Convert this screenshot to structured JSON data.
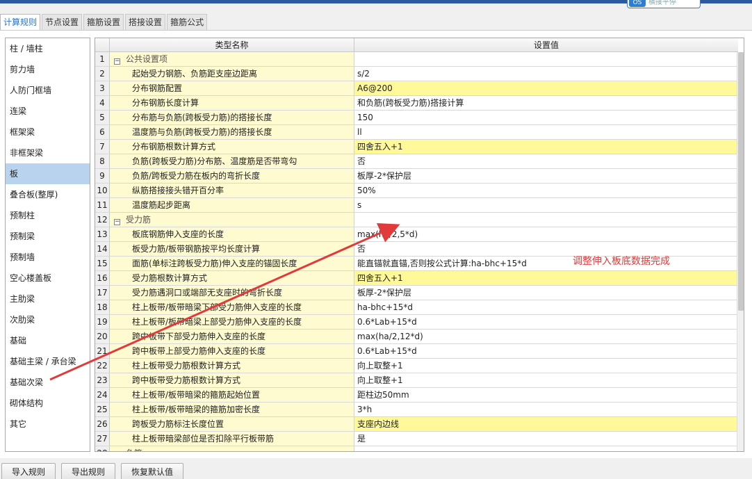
{
  "top_badge": "横接平停",
  "tabs": [
    {
      "label": "计算规则",
      "active": true
    },
    {
      "label": "节点设置"
    },
    {
      "label": "箍筋设置"
    },
    {
      "label": "搭接设置"
    },
    {
      "label": "箍筋公式"
    }
  ],
  "sidebar": {
    "items": [
      {
        "label": "柱 / 墙柱"
      },
      {
        "label": "剪力墙"
      },
      {
        "label": "人防门框墙"
      },
      {
        "label": "连梁"
      },
      {
        "label": "框架梁"
      },
      {
        "label": "非框架梁"
      },
      {
        "label": "板",
        "active": true
      },
      {
        "label": "叠合板(整厚)"
      },
      {
        "label": "预制柱"
      },
      {
        "label": "预制梁"
      },
      {
        "label": "预制墙"
      },
      {
        "label": "空心楼盖板"
      },
      {
        "label": "主肋梁"
      },
      {
        "label": "次肋梁"
      },
      {
        "label": "基础"
      },
      {
        "label": "基础主梁 / 承台梁"
      },
      {
        "label": "基础次梁"
      },
      {
        "label": "砌体结构"
      },
      {
        "label": "其它"
      }
    ]
  },
  "grid": {
    "header": {
      "num": "",
      "name": "类型名称",
      "value": "设置值"
    },
    "rows": [
      {
        "n": "1",
        "name": "公共设置项",
        "value": "",
        "group": true,
        "toggle": "−"
      },
      {
        "n": "2",
        "name": "起始受力钢筋、负筋距支座边距离",
        "value": "s/2"
      },
      {
        "n": "3",
        "name": "分布钢筋配置",
        "value": "A6@200",
        "hl": true
      },
      {
        "n": "4",
        "name": "分布钢筋长度计算",
        "value": "和负筋(跨板受力筋)搭接计算"
      },
      {
        "n": "5",
        "name": "分布筋与负筋(跨板受力筋)的搭接长度",
        "value": "150"
      },
      {
        "n": "6",
        "name": "温度筋与负筋(跨板受力筋)的搭接长度",
        "value": "ll"
      },
      {
        "n": "7",
        "name": "分布钢筋根数计算方式",
        "value": "四舍五入+1",
        "hl": true
      },
      {
        "n": "8",
        "name": "负筋(跨板受力筋)分布筋、温度筋是否带弯勾",
        "value": "否"
      },
      {
        "n": "9",
        "name": "负筋/跨板受力筋在板内的弯折长度",
        "value": "板厚-2*保护层"
      },
      {
        "n": "10",
        "name": "纵筋搭接接头错开百分率",
        "value": "50%"
      },
      {
        "n": "11",
        "name": "温度筋起步距离",
        "value": "s"
      },
      {
        "n": "12",
        "name": "受力筋",
        "value": "",
        "group": true,
        "toggle": "−"
      },
      {
        "n": "13",
        "name": "板底钢筋伸入支座的长度",
        "value": "max(ha/2,5*d)"
      },
      {
        "n": "14",
        "name": "板受力筋/板带钢筋按平均长度计算",
        "value": "否"
      },
      {
        "n": "15",
        "name": "面筋(单标注跨板受力筋)伸入支座的锚固长度",
        "value": "能直锚就直锚,否则按公式计算:ha-bhc+15*d"
      },
      {
        "n": "16",
        "name": "受力筋根数计算方式",
        "value": "四舍五入+1",
        "hl": true
      },
      {
        "n": "17",
        "name": "受力筋遇洞口或端部无支座时的弯折长度",
        "value": "板厚-2*保护层"
      },
      {
        "n": "18",
        "name": "柱上板带/板带暗梁下部受力筋伸入支座的长度",
        "value": "ha-bhc+15*d"
      },
      {
        "n": "19",
        "name": "柱上板带/板带暗梁上部受力筋伸入支座的长度",
        "value": "0.6*Lab+15*d"
      },
      {
        "n": "20",
        "name": "跨中板带下部受力筋伸入支座的长度",
        "value": "max(ha/2,12*d)"
      },
      {
        "n": "21",
        "name": "跨中板带上部受力筋伸入支座的长度",
        "value": "0.6*Lab+15*d"
      },
      {
        "n": "22",
        "name": "柱上板带受力筋根数计算方式",
        "value": "向上取整+1"
      },
      {
        "n": "23",
        "name": "跨中板带受力筋根数计算方式",
        "value": "向上取整+1"
      },
      {
        "n": "24",
        "name": "柱上板带/板带暗梁的箍筋起始位置",
        "value": "距柱边50mm"
      },
      {
        "n": "25",
        "name": "柱上板带/板带暗梁的箍筋加密长度",
        "value": "3*h"
      },
      {
        "n": "26",
        "name": "跨板受力筋标注长度位置",
        "value": "支座内边线",
        "hl": true
      },
      {
        "n": "27",
        "name": "柱上板带暗梁部位是否扣除平行板带筋",
        "value": "是"
      },
      {
        "n": "28",
        "name": "负筋",
        "value": "",
        "group": true,
        "toggle": "−"
      }
    ]
  },
  "annotation": {
    "text": "调整伸入板底数据完成",
    "color": "#e03a3a"
  },
  "buttons": {
    "import": "导入规则",
    "export": "导出规则",
    "restore": "恢复默认值"
  }
}
